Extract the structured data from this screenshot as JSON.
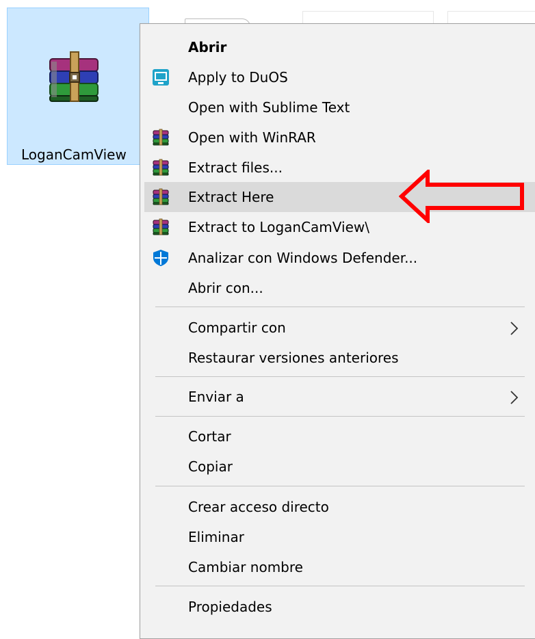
{
  "desktop": {
    "file": {
      "name": "LoganCamView",
      "icon": "winrar-archive-icon"
    }
  },
  "context_menu": {
    "items": [
      {
        "label": "Abrir",
        "bold": true,
        "icon": null
      },
      {
        "label": "Apply to DuOS",
        "icon": "duos-icon"
      },
      {
        "label": "Open with Sublime Text",
        "icon": null
      },
      {
        "label": "Open with WinRAR",
        "icon": "winrar-icon"
      },
      {
        "label": "Extract files...",
        "icon": "winrar-icon"
      },
      {
        "label": "Extract Here",
        "icon": "winrar-icon",
        "highlighted": true
      },
      {
        "label": "Extract to LoganCamView\\",
        "icon": "winrar-icon"
      },
      {
        "label": "Analizar con Windows Defender...",
        "icon": "windows-defender-icon"
      },
      {
        "label": "Abrir con...",
        "icon": null
      },
      {
        "label": "Compartir con",
        "submenu": true
      },
      {
        "label": "Restaurar versiones anteriores"
      },
      {
        "label": "Enviar a",
        "submenu": true
      },
      {
        "label": "Cortar"
      },
      {
        "label": "Copiar"
      },
      {
        "label": "Crear acceso directo"
      },
      {
        "label": "Eliminar"
      },
      {
        "label": "Cambiar nombre"
      },
      {
        "label": "Propiedades"
      }
    ]
  },
  "annotation": {
    "type": "red-arrow",
    "points_to": "Extract Here",
    "color": "#ff0000"
  },
  "colors": {
    "selection": "#cce8ff",
    "menu_bg": "#f2f2f2",
    "hover": "#dadada",
    "accent_blue": "#0078d7"
  }
}
